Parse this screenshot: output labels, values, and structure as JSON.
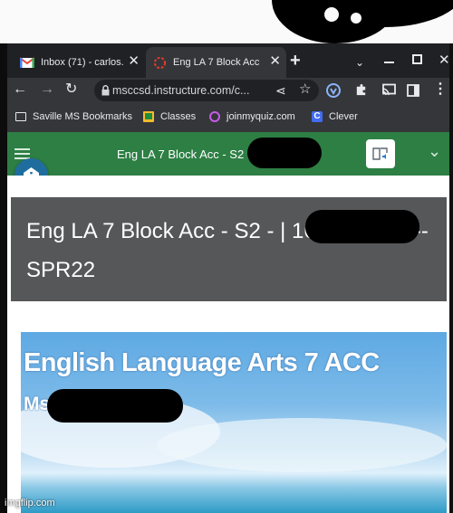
{
  "browser": {
    "tabs": [
      {
        "label": "Inbox (71) - carlos.",
        "icon": "gmail-icon"
      },
      {
        "label": "Eng LA 7 Block Acc",
        "icon": "canvas-icon"
      }
    ],
    "new_tab_symbol": "+",
    "address": {
      "url": "msccsd.instructure.com/c..."
    },
    "bookmarks": [
      {
        "label": "Saville MS Bookmarks",
        "icon": "folder-icon"
      },
      {
        "label": "Classes",
        "icon": "classroom-icon"
      },
      {
        "label": "joinmyquiz.com",
        "icon": "quizizz-icon"
      },
      {
        "label": "Clever",
        "icon": "clever-icon",
        "badge": "C"
      }
    ]
  },
  "canvas": {
    "header_title": "Eng LA 7 Block Acc - S2",
    "course_title": "Eng LA 7 Block Acc - S2 - | 16901002-2 -- SPR22",
    "banner_title": "English Language Arts 7 ACC",
    "banner_subtitle": "Ms"
  },
  "watermark": "imgflip.com",
  "colors": {
    "canvas_green": "#2d7f44",
    "title_card": "#555759",
    "chrome_dark": "#202124",
    "chrome_toolbar": "#35363a"
  }
}
